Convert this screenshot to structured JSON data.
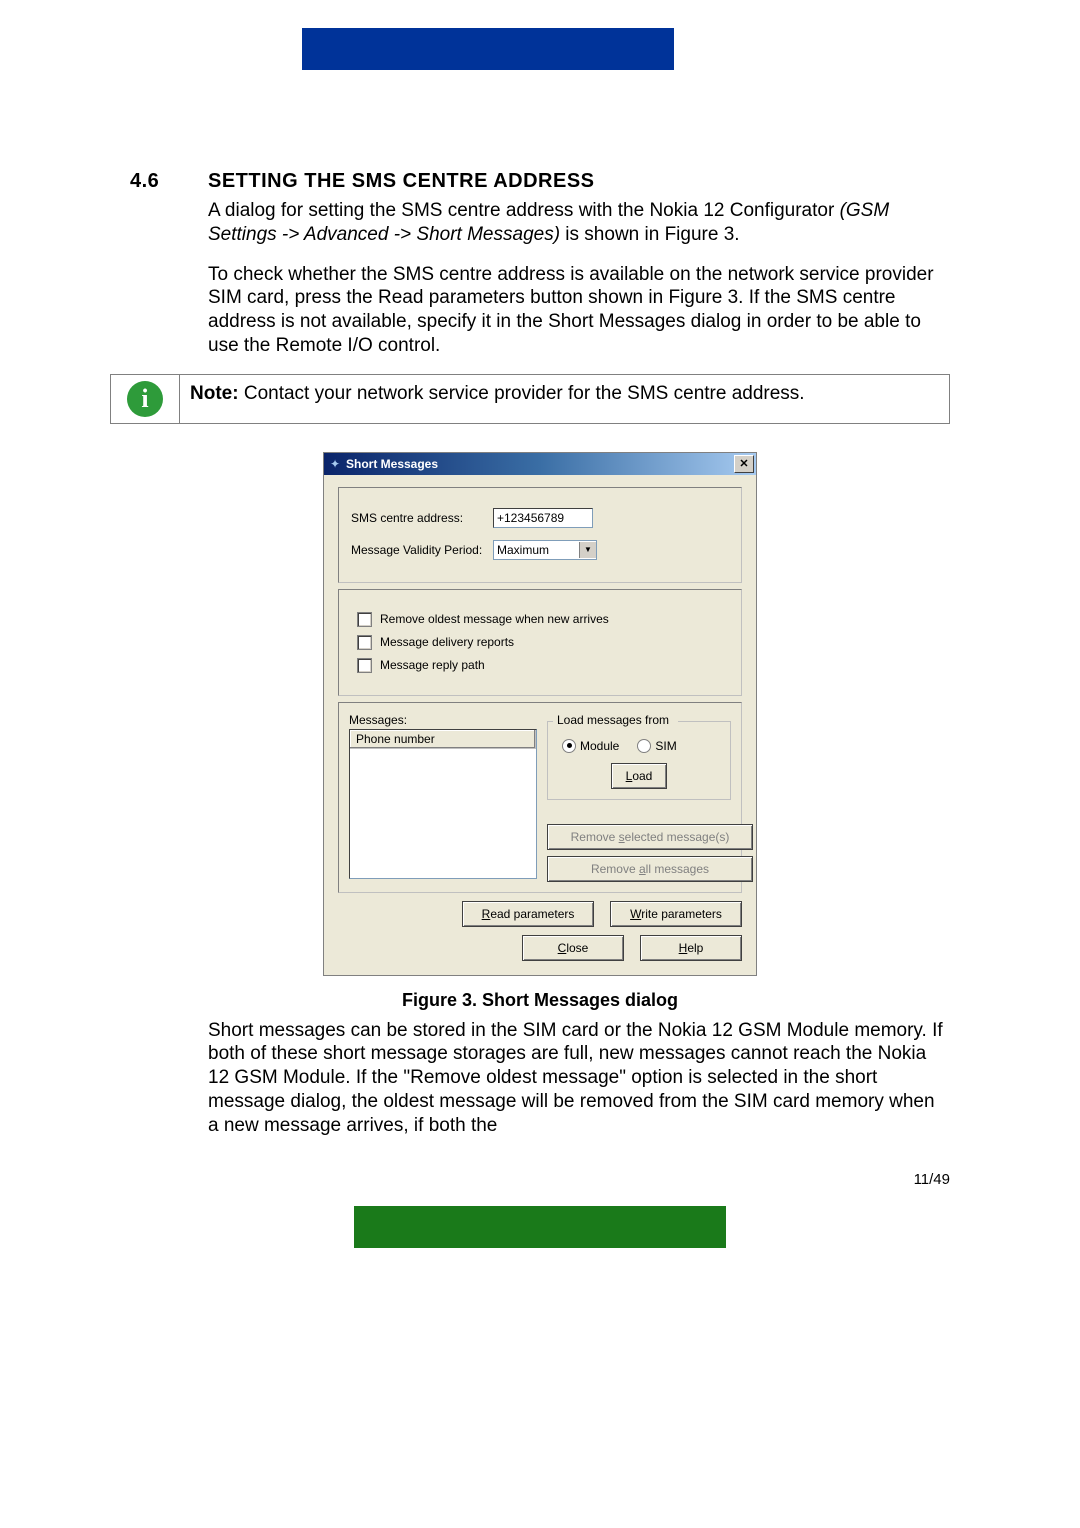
{
  "section": {
    "number": "4.6",
    "title": "SETTING THE SMS CENTRE ADDRESS"
  },
  "para1a": "A dialog for setting the SMS centre address with the Nokia 12 Configurator ",
  "para1b": "(GSM Settings -> Advanced -> Short Messages)",
  "para1c": " is shown in Figure 3.",
  "para2": "To check whether the SMS centre address is available on the network service provider SIM card, press the Read parameters button shown in Figure 3. If the SMS centre address is not available, specify it in the Short Messages dialog in order to be able to use the Remote I/O control.",
  "note_label": "Note:",
  "note_text": " Contact your network service provider for the SMS centre address.",
  "dialog": {
    "title": "Short Messages",
    "sms_addr_label": "SMS centre address:",
    "sms_addr_value": "+123456789",
    "validity_label": "Message Validity Period:",
    "validity_value": "Maximum",
    "chk1": "Remove oldest message when new arrives",
    "chk2": "Message delivery reports",
    "chk3": "Message reply path",
    "messages_label": "Messages:",
    "list_header": "Phone number",
    "group_title": "Load messages from",
    "radio_module": "Module",
    "radio_sim": "SIM",
    "btn_load": "Load",
    "btn_remove_sel": "Remove selected message(s)",
    "btn_remove_all": "Remove all messages",
    "btn_read": "Read parameters",
    "btn_write": "Write parameters",
    "btn_close": "Close",
    "btn_help": "Help"
  },
  "figure_caption": "Figure 3. Short Messages dialog",
  "para3": "Short messages can be stored in the SIM card or the Nokia 12 GSM Module memory. If both of these short message storages are full, new messages cannot reach the Nokia 12 GSM Module. If the \"Remove oldest message\" option is selected in the short message dialog, the oldest message will be removed from the SIM card memory when a new message arrives, if both the",
  "page_number": "11/49"
}
